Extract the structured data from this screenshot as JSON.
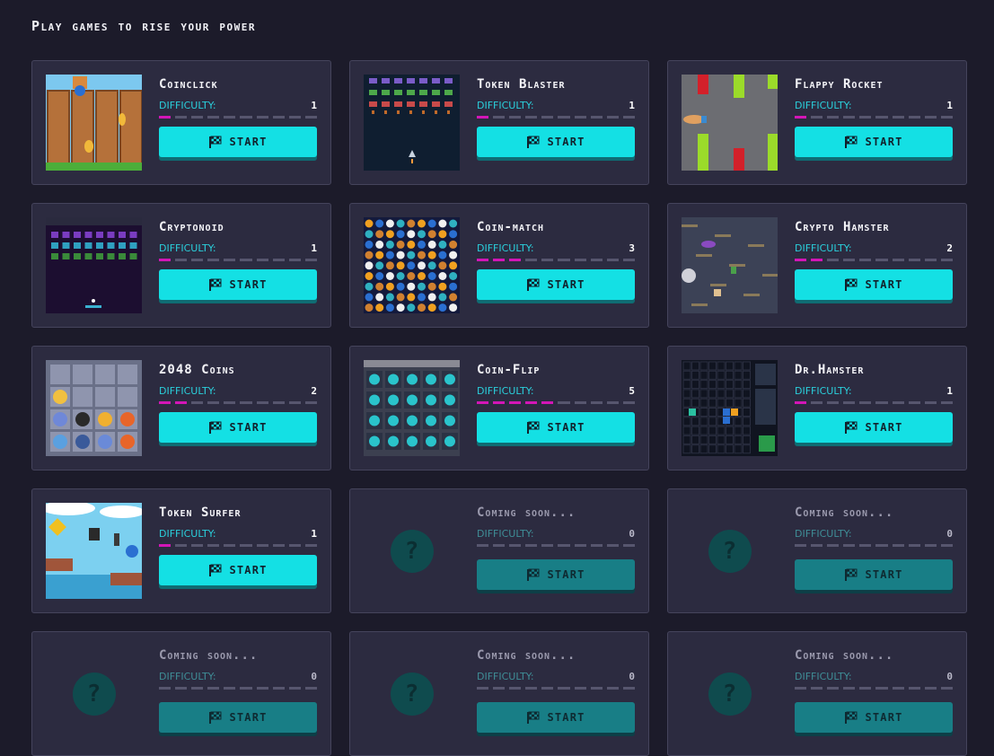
{
  "page": {
    "title": "Play games to rise your power"
  },
  "labels": {
    "difficulty": "DIFFICULTY:",
    "start": "START"
  },
  "colors": {
    "background": "#1c1b2a",
    "card": "#2c2b40",
    "accent": "#14e0e4",
    "difficulty_on": "#d316b7",
    "difficulty_off": "#57566e"
  },
  "games": [
    {
      "title": "Coinclick",
      "difficulty": 1,
      "difficulty_text": "1",
      "thumb": "coinclick",
      "available": true
    },
    {
      "title": "Token Blaster",
      "difficulty": 1,
      "difficulty_text": "1",
      "thumb": "blaster",
      "available": true
    },
    {
      "title": "Flappy Rocket",
      "difficulty": 1,
      "difficulty_text": "1",
      "thumb": "flappy",
      "available": true
    },
    {
      "title": "Cryptonoid",
      "difficulty": 1,
      "difficulty_text": "1",
      "thumb": "cryptonoid",
      "available": true
    },
    {
      "title": "Coin-match",
      "difficulty": 3,
      "difficulty_text": "3",
      "thumb": "coinmatch",
      "available": true
    },
    {
      "title": "Crypto Hamster",
      "difficulty": 2,
      "difficulty_text": "2",
      "thumb": "hamster",
      "available": true
    },
    {
      "title": "2048 Coins",
      "difficulty": 2,
      "difficulty_text": "2",
      "thumb": "coins2048",
      "available": true
    },
    {
      "title": "Coin-Flip",
      "difficulty": 5,
      "difficulty_text": "5",
      "thumb": "coinflip",
      "available": true
    },
    {
      "title": "Dr.Hamster",
      "difficulty": 1,
      "difficulty_text": "1",
      "thumb": "drhamster",
      "available": true
    },
    {
      "title": "Token Surfer",
      "difficulty": 1,
      "difficulty_text": "1",
      "thumb": "surfer",
      "available": true
    },
    {
      "title": "Coming soon...",
      "difficulty": 0,
      "difficulty_text": "0",
      "thumb": "question-icon",
      "available": false
    },
    {
      "title": "Coming soon...",
      "difficulty": 0,
      "difficulty_text": "0",
      "thumb": "question-icon",
      "available": false
    },
    {
      "title": "Coming soon...",
      "difficulty": 0,
      "difficulty_text": "0",
      "thumb": "question-icon",
      "available": false
    },
    {
      "title": "Coming soon...",
      "difficulty": 0,
      "difficulty_text": "0",
      "thumb": "question-icon",
      "available": false
    },
    {
      "title": "Coming soon...",
      "difficulty": 0,
      "difficulty_text": "0",
      "thumb": "question-icon",
      "available": false
    }
  ],
  "difficulty_max": 10
}
